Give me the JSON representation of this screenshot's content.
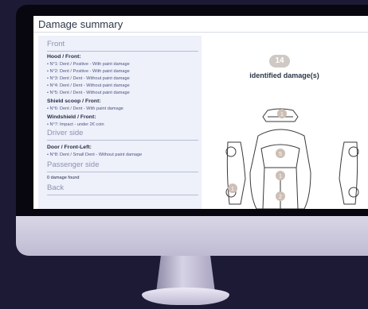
{
  "title": "Damage summary",
  "sections": {
    "front": "Front",
    "driver": "Driver side",
    "passenger": "Passenger side",
    "back": "Back"
  },
  "groups": [
    {
      "heading": "Hood / Front:",
      "items": [
        "• N°1: Dent / Positive - With paint damage",
        "• N°2: Dent / Positive - With paint damage",
        "• N°3: Dent / Dent - Without paint damage",
        "• N°4: Dent / Dent - Without paint damage",
        "• N°5: Dent / Dent - Without paint damage"
      ]
    },
    {
      "heading": "Shield scoop / Front:",
      "items": [
        "• N°6: Dent / Dent - With paint damage"
      ]
    },
    {
      "heading": "Windshield / Front:",
      "items": [
        "• N°7: Impact - under 2€ coin"
      ]
    },
    {
      "heading": "Door / Front-Left:",
      "items": [
        "• N°8: Dent / Small Dent - Without paint damage"
      ]
    }
  ],
  "passenger_note": "0 damage found",
  "summary": {
    "count": "14",
    "label": "identified damage(s)"
  },
  "markers": [
    "1",
    "5",
    "1",
    "1",
    "2"
  ],
  "colors": {
    "background": "#1d1a35",
    "panel": "#eef0fa",
    "badge": "#cfc8c3",
    "marker": "#cdbfb6"
  }
}
